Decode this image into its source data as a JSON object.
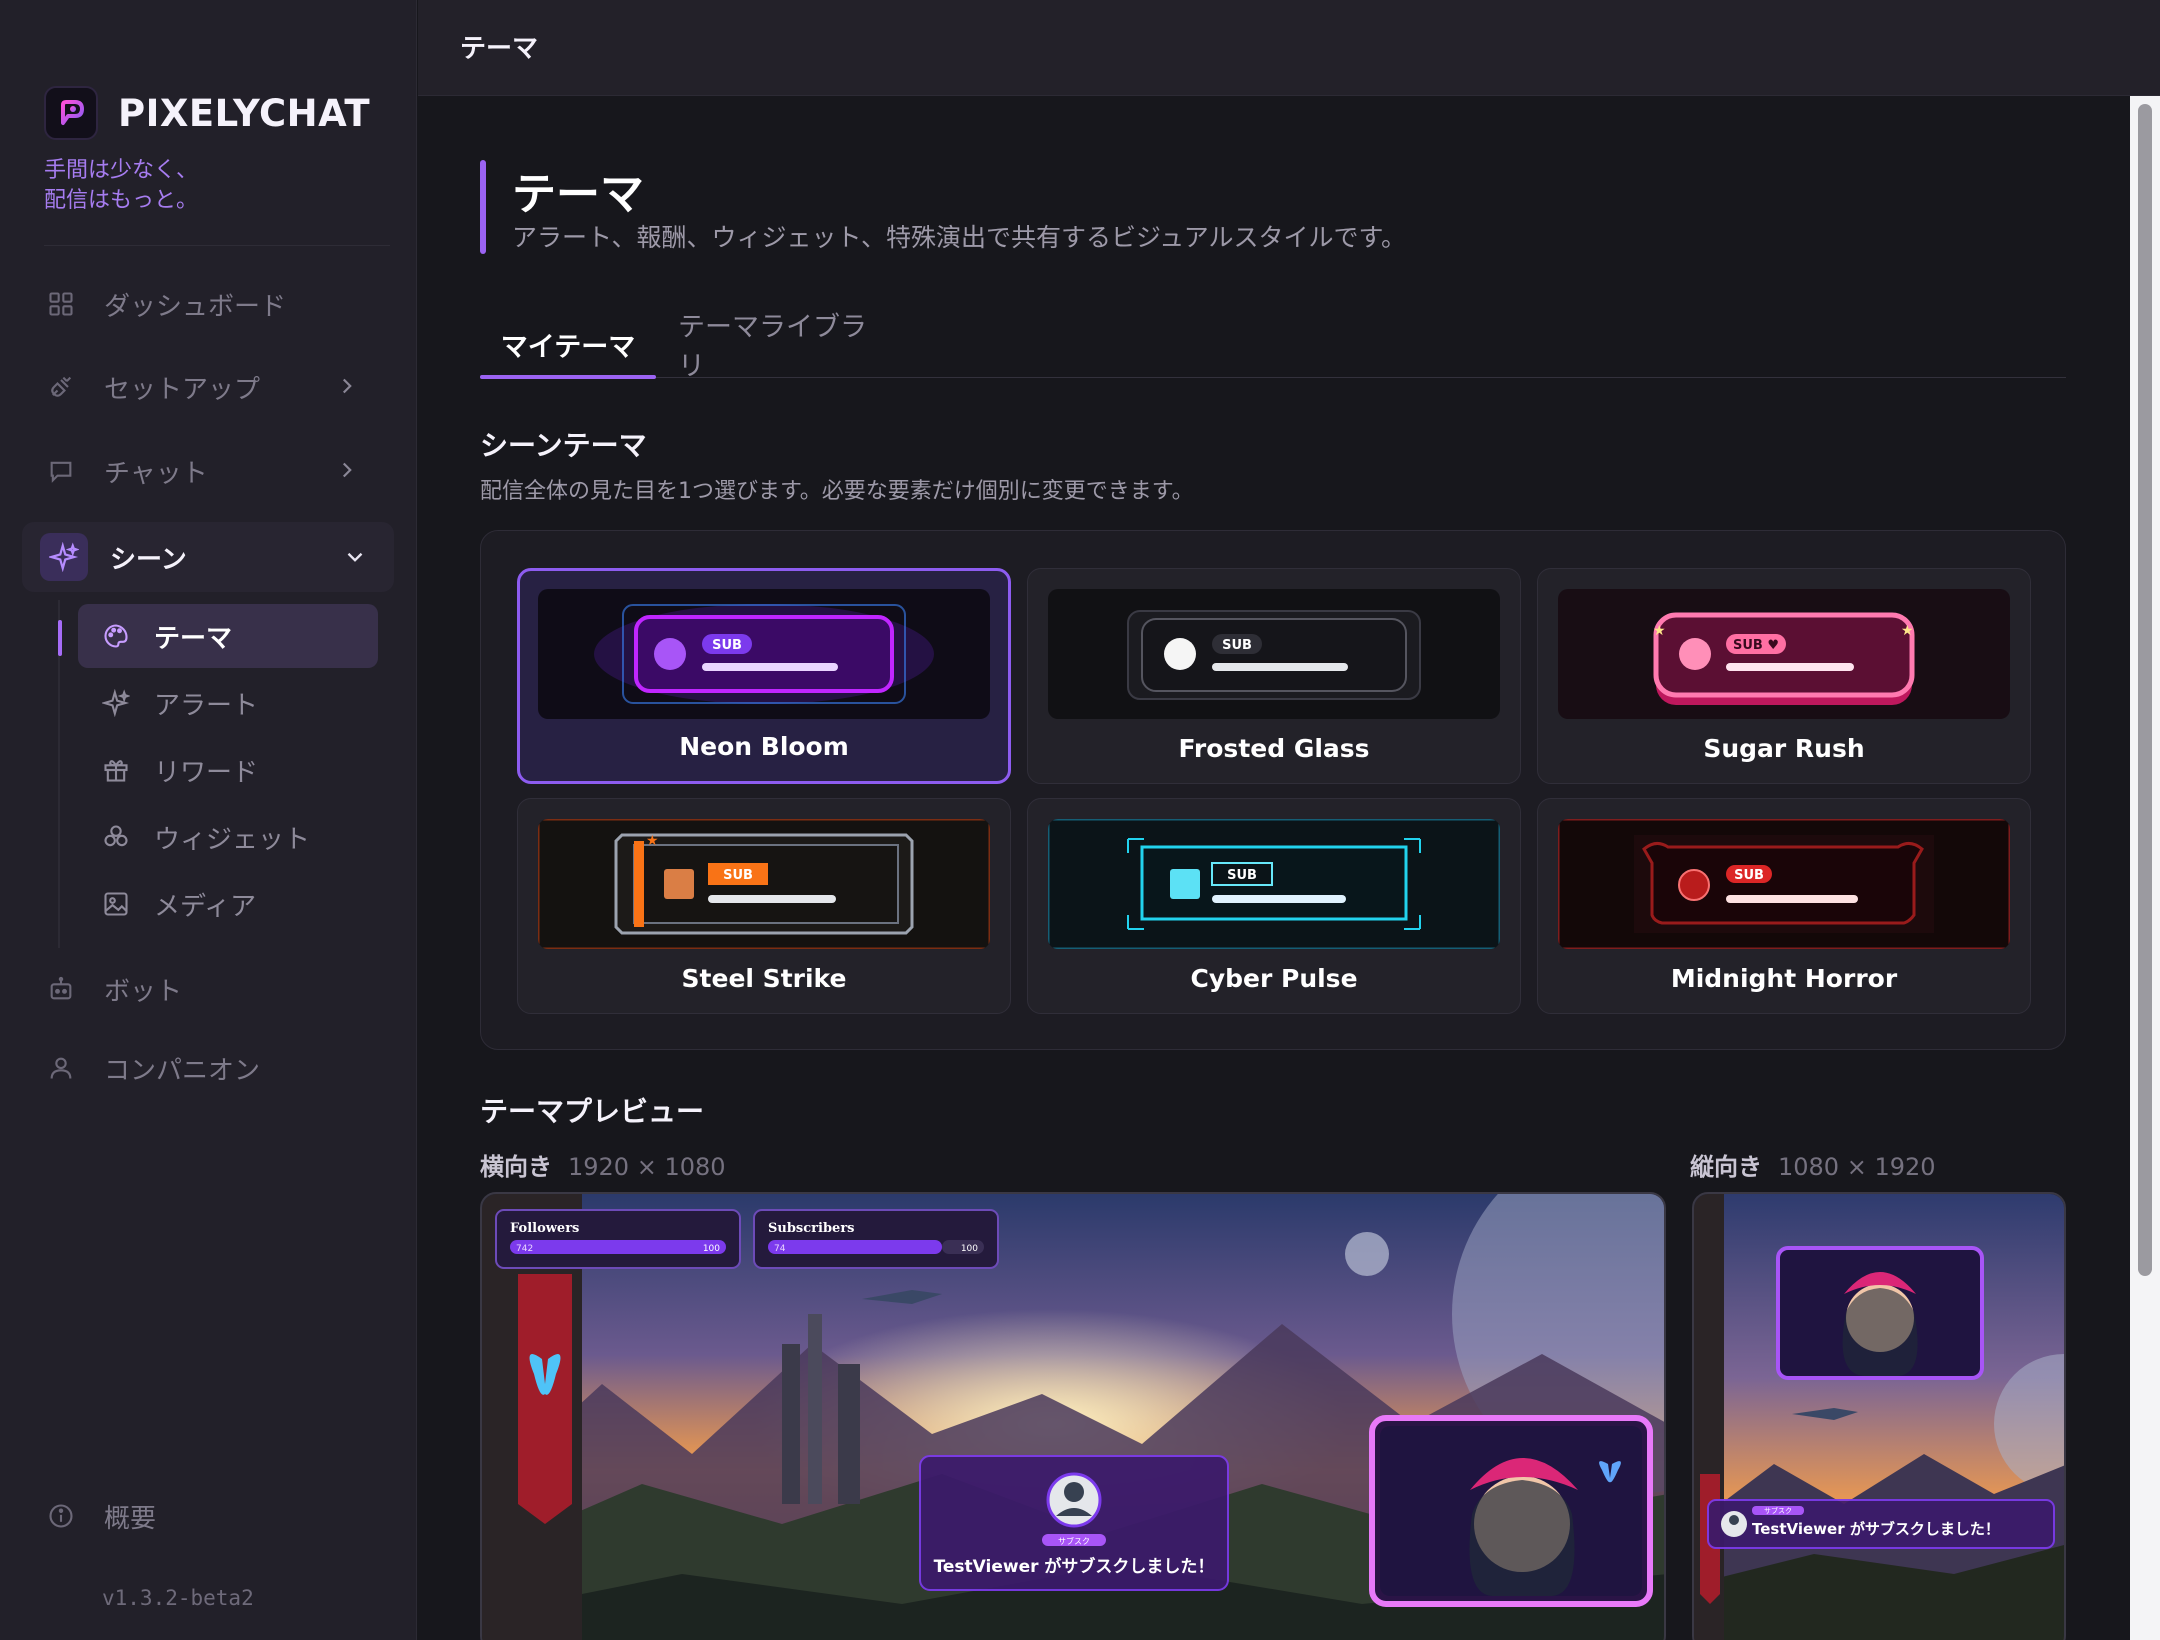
{
  "app": {
    "brand": "PIXELYCHAT",
    "tagline_line1": "手間は少なく、",
    "tagline_line2": "配信はもっと。",
    "version": "v1.3.2-beta2"
  },
  "topbar": {
    "title": "テーマ"
  },
  "nav": {
    "dashboard": "ダッシュボード",
    "setup": "セットアップ",
    "chat": "チャット",
    "scene": "シーン",
    "scene_children": {
      "theme": "テーマ",
      "alert": "アラート",
      "reward": "リワード",
      "widget": "ウィジェット",
      "media": "メディア"
    },
    "bot": "ボット",
    "companion": "コンパニオン",
    "about": "概要"
  },
  "page": {
    "title": "テーマ",
    "subtitle": "アラート、報酬、ウィジェット、特殊演出で共有するビジュアルスタイルです。"
  },
  "tabs": {
    "my_themes": "マイテーマ",
    "library": "テーマライブラリ"
  },
  "scene_themes": {
    "title": "シーンテーマ",
    "description": "配信全体の見た目を1つ選びます。必要な要素だけ個別に変更できます。",
    "badge": "SUB",
    "badge_sugar": "SUB ♥",
    "items": [
      {
        "name": "Neon Bloom",
        "selected": true,
        "accent": "#a855f7"
      },
      {
        "name": "Frosted Glass",
        "selected": false,
        "accent": "#e5e7eb"
      },
      {
        "name": "Sugar Rush",
        "selected": false,
        "accent": "#ff6fa3"
      },
      {
        "name": "Steel Strike",
        "selected": false,
        "accent": "#f97316"
      },
      {
        "name": "Cyber Pulse",
        "selected": false,
        "accent": "#22d3ee"
      },
      {
        "name": "Midnight Horror",
        "selected": false,
        "accent": "#dc2626"
      }
    ]
  },
  "preview": {
    "title": "テーマプレビュー",
    "landscape_label": "横向き",
    "landscape_size": "1920 × 1080",
    "portrait_label": "縦向き",
    "portrait_size": "1080 × 1920",
    "goal1_label": "Followers",
    "goal1_current": "742",
    "goal1_target": "100",
    "goal2_label": "Subscribers",
    "goal2_current": "74",
    "goal2_target": "100",
    "alert_text": "TestViewer がサブスクしました！",
    "alert_badge": "サブスク"
  }
}
